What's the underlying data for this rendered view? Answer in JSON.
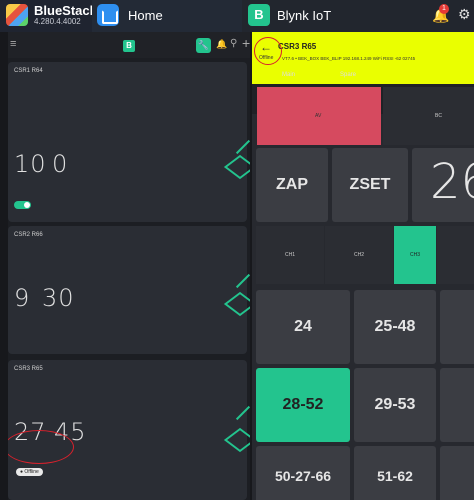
{
  "taskbar": {
    "bluestacks_title": "BlueStacks",
    "bluestacks_version": "4.280.4.4002",
    "home_label": "Home",
    "blynk_label": "Blynk IoT",
    "notification_count": "1"
  },
  "left": {
    "cards": [
      {
        "title": "CSR1 R64",
        "value_a": "10",
        "value_b": "0",
        "toggle_on": true
      },
      {
        "title": "CSR2 R66",
        "value_a": "9",
        "value_b": "30"
      },
      {
        "title": "CSR3 R65",
        "value_a": "27",
        "value_b": "45",
        "status": "Offline"
      }
    ]
  },
  "right": {
    "title": "CSR3 R65",
    "status": "Offline",
    "subtitle": "VT7.6 • BEK_BOX     BEK_BLIP 192.168.1.249 WiFi RSSI -62 02745",
    "tabs": [
      "Main",
      "Spare"
    ],
    "switches": [
      {
        "label": "AV",
        "color": "#d64a5f"
      },
      {
        "label": "BC",
        "color": "#2b2d33"
      }
    ],
    "buttons_row1": [
      "ZAP",
      "ZSET"
    ],
    "big_value": "26",
    "segments": [
      {
        "label": "CH1",
        "active": false
      },
      {
        "label": "CH2",
        "active": false
      },
      {
        "label": "CH3",
        "active": true
      }
    ],
    "buttons": [
      {
        "label": "24",
        "active": false
      },
      {
        "label": "25-48",
        "active": false
      },
      {
        "label": "28-52",
        "active": true
      },
      {
        "label": "29-53",
        "active": false
      },
      {
        "label": "50-27-66",
        "active": false
      },
      {
        "label": "51-62",
        "active": false
      }
    ]
  },
  "colors": {
    "accent": "#23c48e",
    "header_yellow": "#eaff00",
    "alert_red": "#d8212c"
  }
}
